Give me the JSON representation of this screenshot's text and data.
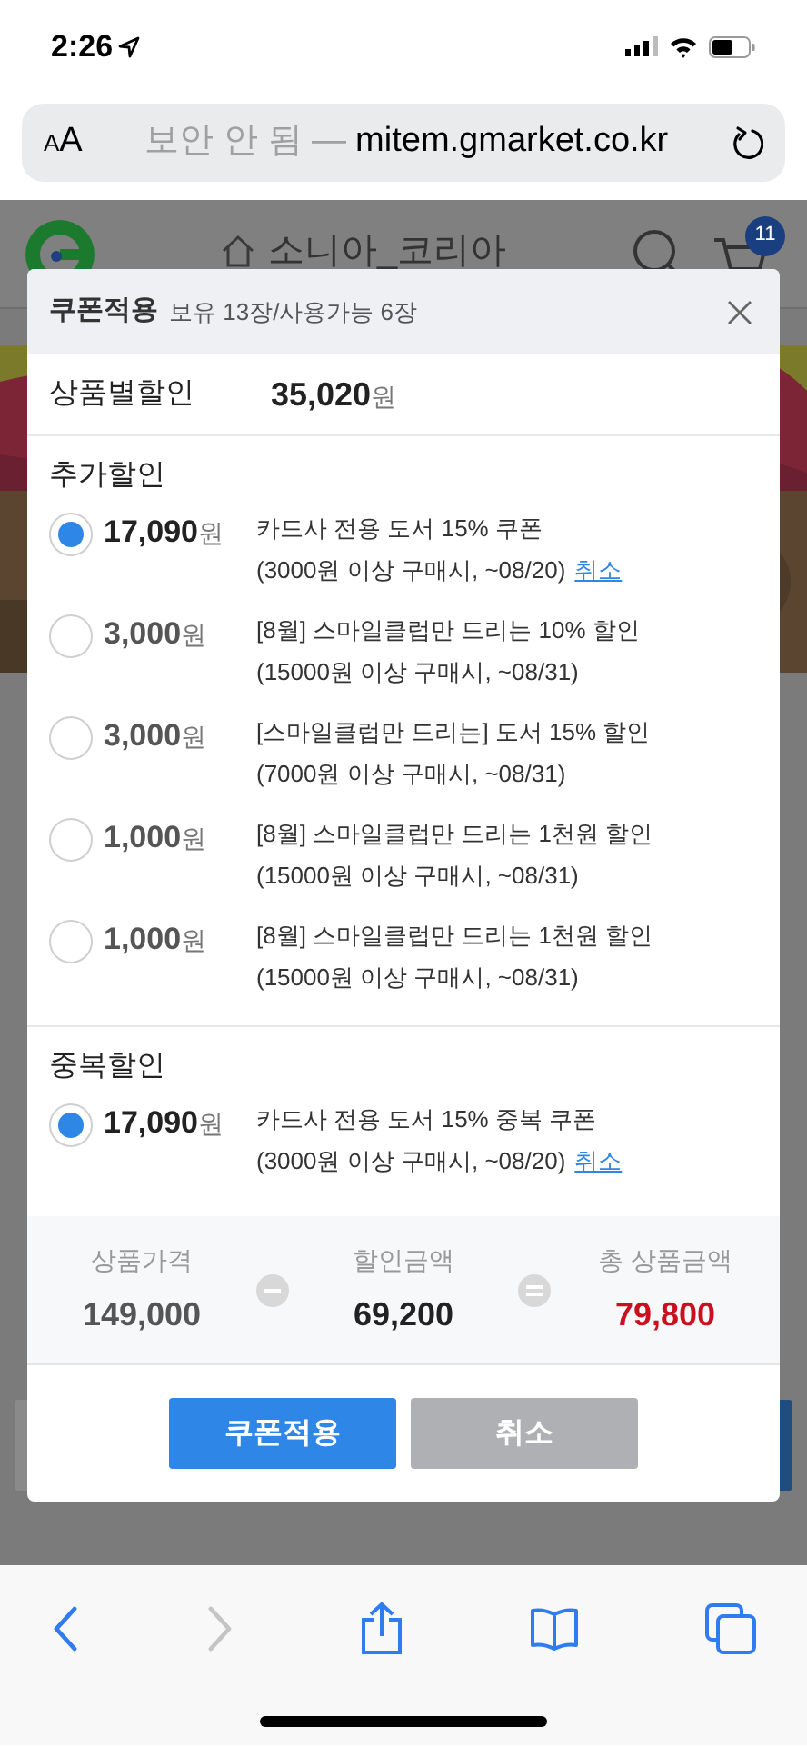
{
  "status_bar": {
    "time": "2:26"
  },
  "browser": {
    "text_size_button": "AA",
    "security_note": "보안 안 됨 —",
    "domain": "mitem.gmarket.co.kr"
  },
  "page_header": {
    "title": "소니아_코리아",
    "cart_count": "11"
  },
  "coupon_dialog": {
    "title": "쿠폰적용",
    "subtitle": "보유 13장/사용가능 6장",
    "product_discount": {
      "label": "상품별할인",
      "amount": "35,020원"
    },
    "sections": [
      {
        "title": "추가할인",
        "coupons": [
          {
            "amount": "17,090원",
            "name": "카드사 전용 도서 15% 쿠폰",
            "condition": "(3000원 이상 구매시, ~08/20)",
            "cancel": "취소",
            "selected": true
          },
          {
            "amount": "3,000원",
            "name": "[8월] 스마일클럽만 드리는 10% 할인",
            "condition": "(15000원 이상 구매시, ~08/31)",
            "selected": false
          },
          {
            "amount": "3,000원",
            "name": "[스마일클럽만 드리는] 도서 15% 할인",
            "condition": "(7000원 이상 구매시, ~08/31)",
            "selected": false
          },
          {
            "amount": "1,000원",
            "name": "[8월] 스마일클럽만 드리는 1천원 할인",
            "condition": "(15000원 이상 구매시, ~08/31)",
            "selected": false
          },
          {
            "amount": "1,000원",
            "name": "[8월] 스마일클럽만 드리는 1천원 할인",
            "condition": "(15000원 이상 구매시, ~08/31)",
            "selected": false
          }
        ]
      },
      {
        "title": "중복할인",
        "coupons": [
          {
            "amount": "17,090원",
            "name": "카드사 전용 도서 15% 중복 쿠폰",
            "condition": "(3000원 이상 구매시, ~08/20)",
            "cancel": "취소",
            "selected": true
          }
        ]
      }
    ],
    "summary": [
      {
        "kind": "price",
        "label": "상품가격",
        "value": "149,000"
      },
      {
        "kind": "discount",
        "label": "할인금액",
        "value": "69,200"
      },
      {
        "kind": "total",
        "label": "총 상품금액",
        "value": "79,800"
      }
    ],
    "buttons": [
      {
        "kind": "primary",
        "label": "쿠폰적용"
      },
      {
        "kind": "secondary",
        "label": "취소"
      }
    ]
  },
  "toolbar": {
    "forward_disabled": true
  }
}
